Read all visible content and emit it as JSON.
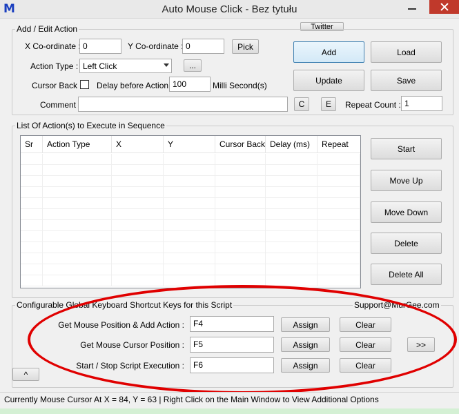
{
  "window": {
    "app_icon_text": "M",
    "title": "Auto Mouse Click - Bez tytułu",
    "twitter_label": "Twitter"
  },
  "add_edit": {
    "legend": "Add / Edit Action",
    "x_label": "X Co-ordinate :",
    "x_value": "0",
    "y_label": "Y Co-ordinate :",
    "y_value": "0",
    "pick_label": "Pick",
    "action_type_label": "Action Type :",
    "action_type_value": "Left Click",
    "ellipsis_label": "...",
    "cursor_back_label": "Cursor Back :",
    "cursor_back_checked": false,
    "delay_label": "Delay before Action :",
    "delay_value": "100",
    "delay_unit": "Milli Second(s)",
    "comment_label": "Comment :",
    "comment_value": "",
    "c_label": "C",
    "e_label": "E",
    "repeat_label": "Repeat Count :",
    "repeat_value": "1",
    "add_label": "Add",
    "load_label": "Load",
    "update_label": "Update",
    "save_label": "Save"
  },
  "list": {
    "legend": "List Of Action(s) to Execute in Sequence",
    "columns": [
      "Sr",
      "Action Type",
      "X",
      "Y",
      "Cursor Back",
      "Delay (ms)",
      "Repeat"
    ],
    "rows": [],
    "start_label": "Start",
    "move_up_label": "Move Up",
    "move_down_label": "Move Down",
    "delete_label": "Delete",
    "delete_all_label": "Delete All"
  },
  "shortcuts": {
    "legend": "Configurable Global Keyboard Shortcut Keys for this Script",
    "support_email": "Support@MurGee.com",
    "items": [
      {
        "label": "Get Mouse Position & Add Action :",
        "key": "F4",
        "assign": "Assign",
        "clear": "Clear"
      },
      {
        "label": "Get Mouse Cursor Position :",
        "key": "F5",
        "assign": "Assign",
        "clear": "Clear"
      },
      {
        "label": "Start / Stop Script Execution :",
        "key": "F6",
        "assign": "Assign",
        "clear": "Clear"
      }
    ],
    "more_label": ">>",
    "collapse_label": "^"
  },
  "status": {
    "text": "Currently Mouse Cursor At X = 84, Y = 63 | Right Click on the Main Window to View Additional Options"
  },
  "colors": {
    "highlight": "#e00000",
    "accent": "#3c7fb1",
    "app_icon": "#1a3fbf"
  }
}
